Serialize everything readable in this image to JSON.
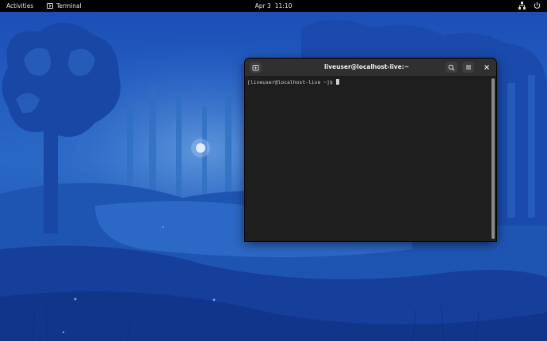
{
  "topbar": {
    "activities_label": "Activities",
    "app_label": "Terminal",
    "app_icon": "terminal-icon",
    "date": "Apr 3",
    "time": "11:10",
    "tray_icons": [
      "network-icon",
      "power-icon"
    ]
  },
  "window": {
    "title": "liveuser@localhost-live:~",
    "buttons": {
      "new_tab_icon": "new-tab-icon",
      "search_icon": "search-icon",
      "menu_icon": "hamburger-menu-icon",
      "close_icon": "close-icon"
    },
    "prompt": "[liveuser@localhost-live ~]$ "
  },
  "colors": {
    "topbar_bg": "#000000",
    "terminal_bg": "#1e1e1e",
    "headerbar_bg": "#303030",
    "wallpaper_primary": "#1a48b8"
  }
}
